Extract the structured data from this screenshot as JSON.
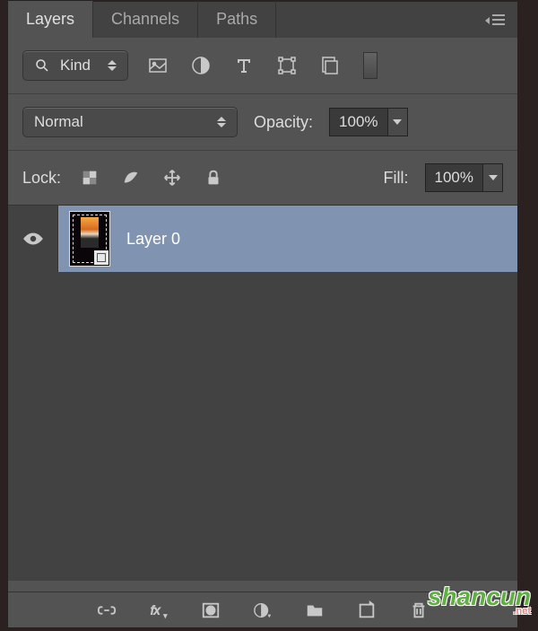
{
  "tabs": {
    "layers": "Layers",
    "channels": "Channels",
    "paths": "Paths"
  },
  "filter": {
    "kind": "Kind"
  },
  "blend": {
    "mode": "Normal",
    "opacity_label": "Opacity:",
    "opacity_value": "100%"
  },
  "lock": {
    "label": "Lock:",
    "fill_label": "Fill:",
    "fill_value": "100%"
  },
  "layers": [
    {
      "name": "Layer 0",
      "visible": true,
      "selected": true
    }
  ],
  "watermark": {
    "text": "shancun",
    "ext": ".net"
  }
}
